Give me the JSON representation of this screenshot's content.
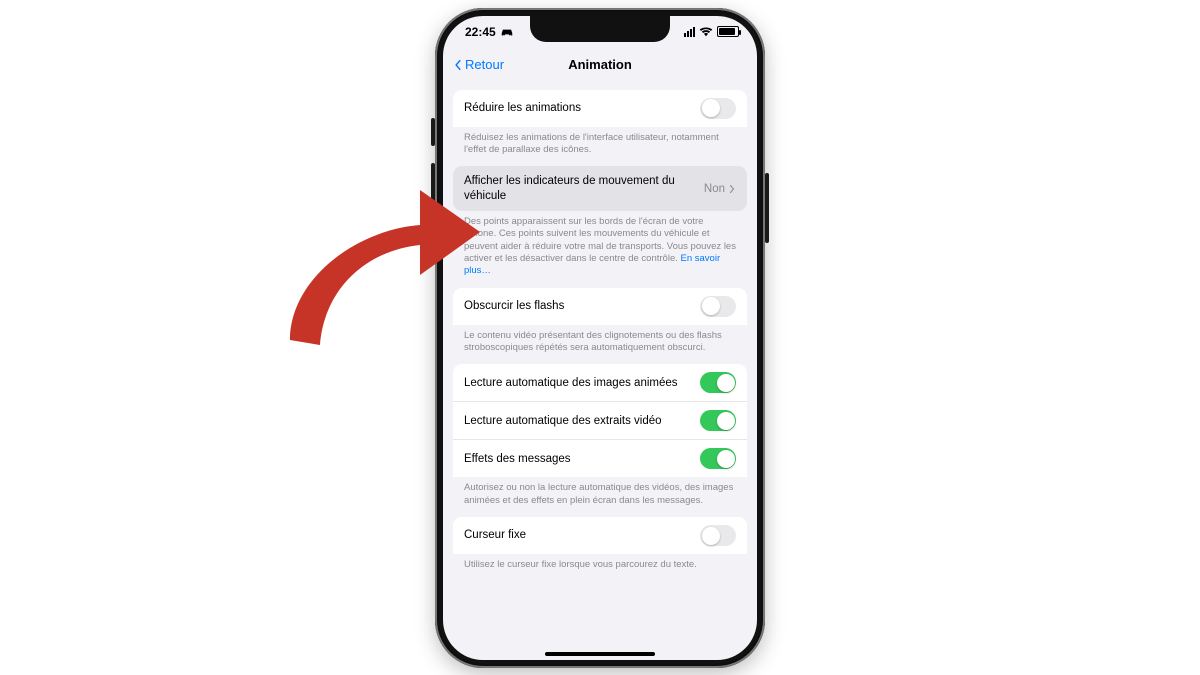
{
  "status": {
    "time": "22:45"
  },
  "nav": {
    "back": "Retour",
    "title": "Animation"
  },
  "rows": {
    "reduce_motion": "Réduire les animations",
    "reduce_motion_footer": "Réduisez les animations de l'interface utilisateur, notamment l'effet de parallaxe des icônes.",
    "vehicle_cues": "Afficher les indicateurs de mouvement du véhicule",
    "vehicle_cues_value": "Non",
    "vehicle_cues_footer": "Des points apparaissent sur les bords de l'écran de votre iPhone. Ces points suivent les mouvements du véhicule et peuvent aider à réduire votre mal de transports. Vous pouvez les activer et les désactiver dans le centre de contrôle. ",
    "vehicle_cues_link": "En savoir plus…",
    "dim_flashing": "Obscurcir les flashs",
    "dim_flashing_footer": "Le contenu vidéo présentant des clignotements ou des flashs stroboscopiques répétés sera automatiquement obscurci.",
    "autoplay_images": "Lecture automatique des images animées",
    "autoplay_previews": "Lecture automatique des extraits vidéo",
    "message_effects": "Effets des messages",
    "autoplay_footer": "Autorisez ou non la lecture automatique des vidéos, des images animées et des effets en plein écran dans les messages.",
    "fixed_cursor": "Curseur fixe",
    "fixed_cursor_footer": "Utilisez le curseur fixe lorsque vous parcourez du texte."
  },
  "colors": {
    "arrow": "#c63327"
  }
}
